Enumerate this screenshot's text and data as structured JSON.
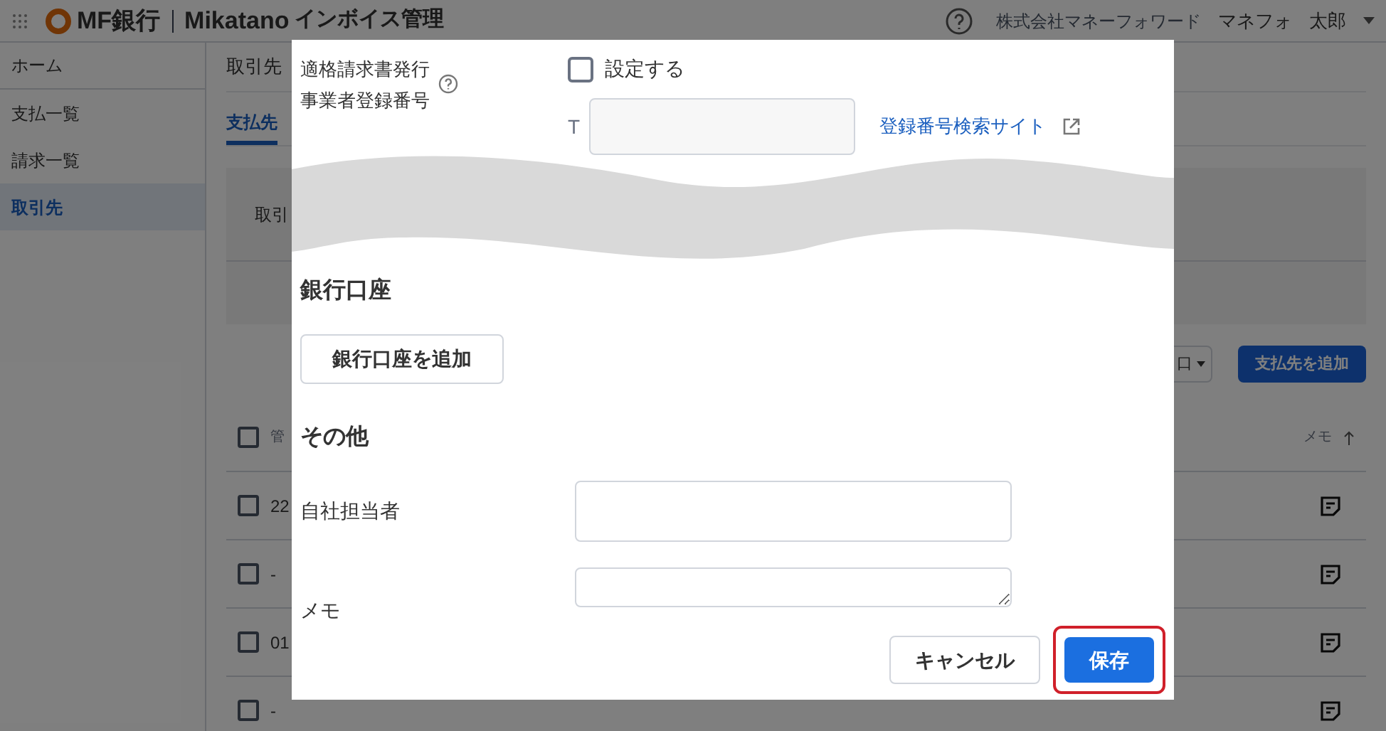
{
  "header": {
    "app_name": "MF銀行",
    "product": "Mikatano",
    "product_suffix": "インボイス管理",
    "company": "株式会社マネーフォワード",
    "user_family": "マネフォ",
    "user_given": "太郎"
  },
  "sidebar": {
    "items": [
      {
        "label": "ホーム",
        "selected": false
      },
      {
        "label": "支払一覧",
        "selected": false
      },
      {
        "label": "請求一覧",
        "selected": false
      },
      {
        "label": "取引先",
        "selected": true
      }
    ]
  },
  "page": {
    "title": "取引先",
    "tabs": [
      {
        "label": "支払先",
        "selected": true
      }
    ],
    "filter_label": "取引",
    "dropdown": "口",
    "add_button": "支払先を追加",
    "table": {
      "select_all_checked": false,
      "column_1": "管",
      "memo_column": "メモ",
      "rows": [
        {
          "checked": false,
          "column_1": "22"
        },
        {
          "checked": false,
          "column_1": "-"
        },
        {
          "checked": false,
          "column_1": "01"
        },
        {
          "checked": false,
          "column_1": "-"
        }
      ]
    }
  },
  "dialog": {
    "invoice_label_1": "適格請求書発行",
    "invoice_label_2": "事業者登録番号",
    "invoice_checkbox": {
      "label": "設定する",
      "checked": false
    },
    "prefix": "T",
    "search_link": "登録番号検索サイト",
    "bank_heading": "銀行口座",
    "add_bank_button": "銀行口座を追加",
    "other_heading": "その他",
    "fields": [
      {
        "label": "自社担当者",
        "kind": "input"
      },
      {
        "label": "メモ",
        "kind": "textarea"
      }
    ],
    "cancel_button": "キャンセル",
    "save_button": {
      "label": "保存",
      "highlighted": true
    }
  }
}
